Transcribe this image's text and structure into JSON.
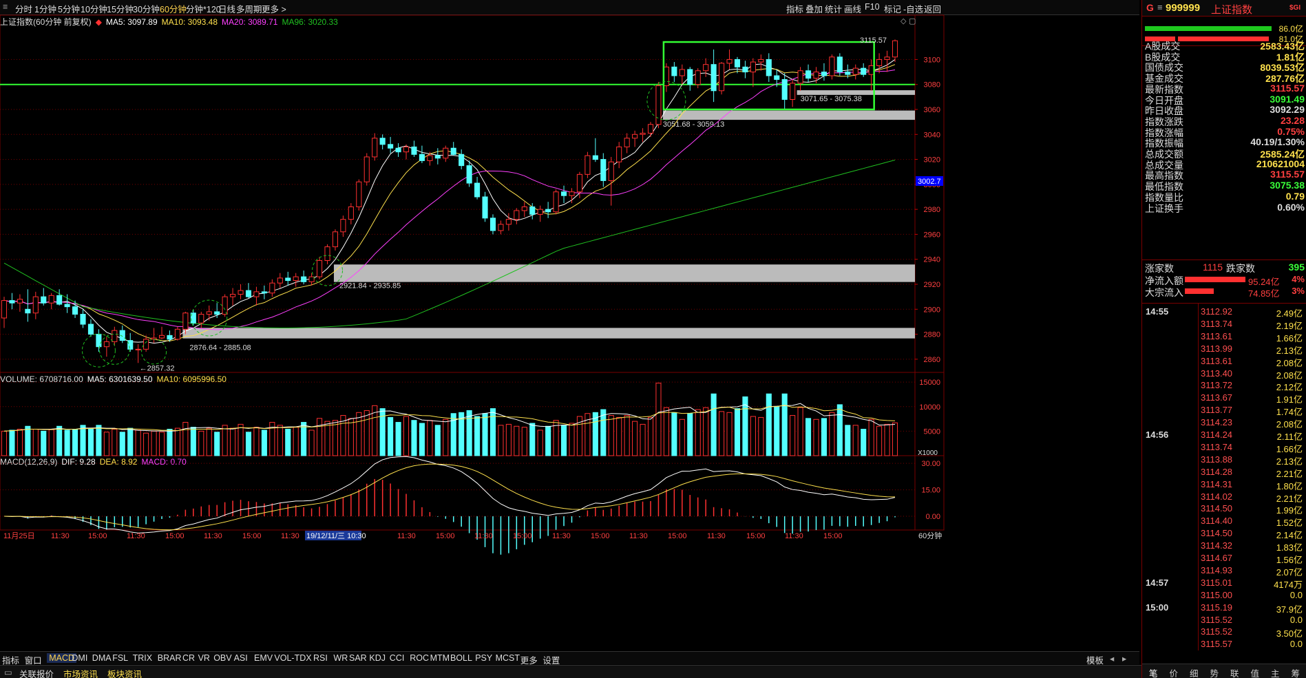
{
  "toolbar": {
    "periods": [
      "分时",
      "1分钟",
      "5分钟",
      "10分钟",
      "15分钟",
      "30分钟",
      "60分钟",
      "分钟*120",
      "日线",
      "多周期",
      "更多 >"
    ],
    "active_period": "60分钟",
    "right_buttons": [
      "指标",
      "叠加",
      "统计",
      "画线",
      "F10",
      "标记",
      "-自选",
      "返回"
    ]
  },
  "header": {
    "code_prefix": "G",
    "code": "999999",
    "name": "上证指数",
    "badge": "$GI"
  },
  "main_info": {
    "title": "上证指数(60分钟 前复权)",
    "ma5": "MA5: 3097.89",
    "ma10": "MA10: 3093.48",
    "ma20": "MA20: 3089.71",
    "ma96": "MA96: 3020.33"
  },
  "volume_info": {
    "title": "VOLUME: 6708716.00",
    "ma5": "MA5: 6301639.50",
    "ma10": "MA10: 6095996.50"
  },
  "macd_info": {
    "title": "MACD(12,26,9)",
    "dif": "DIF: 9.28",
    "dea": "DEA: 8.92",
    "macd": "MACD: 0.70"
  },
  "colors": {
    "up": "#ff3030",
    "down": "#54ffff",
    "ma5": "#ffffff",
    "ma10": "#ffe14d",
    "ma20": "#ff40ff",
    "ma96": "#20c020",
    "box": "#33ff33",
    "band": "#bbbbbb",
    "grid": "#7a0000"
  },
  "chart_data": {
    "type": "candlestick",
    "price_axis": {
      "ylim": [
        2850,
        3130
      ],
      "ticks": [
        2860,
        2880,
        2900,
        2920,
        2940,
        2960,
        2980,
        3000,
        3020,
        3040,
        3060,
        3080,
        3100
      ]
    },
    "volume_axis": {
      "ylim": [
        0,
        16000
      ],
      "ticks": [
        5000,
        10000,
        15000
      ],
      "unit": "X1000"
    },
    "macd_axis": {
      "ylim": [
        -7,
        32
      ],
      "ticks": [
        0.0,
        15.0,
        30.0
      ]
    },
    "current_price_label": "3002.7",
    "time_labels": [
      "11月25日",
      "11:30",
      "15:00",
      "11:30",
      "15:00",
      "11:30",
      "15:00",
      "11:30",
      "15:00",
      "19/12/11/三 10:30",
      "11:30",
      "15:00",
      "11:30",
      "15:00",
      "11:30",
      "15:00",
      "11:30",
      "15:00",
      "11:30",
      "15:00",
      "11:30",
      "15:00"
    ],
    "period_label": "60分钟",
    "annotations": {
      "high": "3115.57",
      "low": "2857.32",
      "zones": [
        "2876.64 - 2885.08",
        "2921.84 - 2935.85",
        "3051.68 - 3059.13",
        "3071.65 - 3075.38"
      ]
    },
    "candles": [
      [
        2893,
        2910,
        2885,
        2907,
        5000
      ],
      [
        2907,
        2913,
        2900,
        2905,
        5200
      ],
      [
        2905,
        2912,
        2898,
        2908,
        5400
      ],
      [
        2900,
        2916,
        2890,
        2897,
        6000
      ],
      [
        2897,
        2914,
        2892,
        2910,
        5400
      ],
      [
        2910,
        2917,
        2903,
        2905,
        5000
      ],
      [
        2905,
        2913,
        2900,
        2911,
        5300
      ],
      [
        2911,
        2916,
        2903,
        2904,
        6000
      ],
      [
        2904,
        2912,
        2897,
        2902,
        5200
      ],
      [
        2902,
        2907,
        2893,
        2896,
        5400
      ],
      [
        2896,
        2900,
        2885,
        2888,
        6200
      ],
      [
        2888,
        2892,
        2878,
        2880,
        5400
      ],
      [
        2880,
        2884,
        2866,
        2870,
        6200
      ],
      [
        2870,
        2878,
        2862,
        2874,
        4800
      ],
      [
        2874,
        2886,
        2871,
        2883,
        5400
      ],
      [
        2883,
        2887,
        2873,
        2875,
        4800
      ],
      [
        2875,
        2881,
        2866,
        2868,
        5600
      ],
      [
        2868,
        2872,
        2857,
        2868,
        5200
      ],
      [
        2868,
        2879,
        2866,
        2876,
        4600
      ],
      [
        2876,
        2885,
        2873,
        2877,
        5000
      ],
      [
        2877,
        2886,
        2876,
        2879,
        4800
      ],
      [
        2879,
        2883,
        2874,
        2876,
        5400
      ],
      [
        2876,
        2886,
        2875,
        2884,
        5600
      ],
      [
        2884,
        2898,
        2880,
        2897,
        6800
      ],
      [
        2897,
        2900,
        2887,
        2889,
        5800
      ],
      [
        2889,
        2898,
        2885,
        2896,
        5000
      ],
      [
        2896,
        2903,
        2891,
        2898,
        5600
      ],
      [
        2898,
        2905,
        2893,
        2896,
        4800
      ],
      [
        2896,
        2912,
        2894,
        2910,
        6200
      ],
      [
        2910,
        2917,
        2903,
        2912,
        5600
      ],
      [
        2912,
        2920,
        2908,
        2915,
        6400
      ],
      [
        2915,
        2921,
        2909,
        2910,
        4800
      ],
      [
        2910,
        2918,
        2903,
        2914,
        5800
      ],
      [
        2914,
        2919,
        2908,
        2913,
        5200
      ],
      [
        2913,
        2924,
        2910,
        2921,
        6800
      ],
      [
        2921,
        2929,
        2917,
        2925,
        6200
      ],
      [
        2925,
        2930,
        2919,
        2923,
        5400
      ],
      [
        2923,
        2929,
        2918,
        2926,
        5800
      ],
      [
        2926,
        2931,
        2920,
        2922,
        6800
      ],
      [
        2922,
        2929,
        2919,
        2926,
        5200
      ],
      [
        2926,
        2942,
        2924,
        2939,
        7600
      ],
      [
        2939,
        2952,
        2936,
        2950,
        7000
      ],
      [
        2950,
        2964,
        2947,
        2962,
        7200
      ],
      [
        2962,
        2975,
        2958,
        2972,
        8200
      ],
      [
        2972,
        2985,
        2968,
        2982,
        7600
      ],
      [
        2982,
        3004,
        2979,
        3002,
        8800
      ],
      [
        3002,
        3025,
        2999,
        3022,
        9200
      ],
      [
        3022,
        3041,
        3019,
        3037,
        10200
      ],
      [
        3037,
        3040,
        3028,
        3032,
        9600
      ],
      [
        3032,
        3038,
        3025,
        3029,
        7800
      ],
      [
        3029,
        3033,
        3022,
        3026,
        6800
      ],
      [
        3026,
        3032,
        3020,
        3030,
        8000
      ],
      [
        3030,
        3035,
        3022,
        3024,
        7200
      ],
      [
        3024,
        3031,
        3017,
        3019,
        6600
      ],
      [
        3019,
        3026,
        3015,
        3023,
        7200
      ],
      [
        3023,
        3029,
        3016,
        3021,
        6200
      ],
      [
        3021,
        3031,
        3018,
        3029,
        7400
      ],
      [
        3029,
        3034,
        3023,
        3024,
        8600
      ],
      [
        3024,
        3028,
        3012,
        3015,
        8800
      ],
      [
        3015,
        3019,
        2998,
        3001,
        9200
      ],
      [
        3001,
        3006,
        2988,
        2990,
        8000
      ],
      [
        2990,
        2994,
        2970,
        2973,
        8600
      ],
      [
        2973,
        2976,
        2960,
        2963,
        9600
      ],
      [
        2963,
        2971,
        2960,
        2968,
        6200
      ],
      [
        2968,
        2977,
        2963,
        2972,
        6400
      ],
      [
        2972,
        2981,
        2968,
        2979,
        6000
      ],
      [
        2979,
        2986,
        2974,
        2982,
        5800
      ],
      [
        2982,
        2985,
        2972,
        2976,
        6600
      ],
      [
        2976,
        2983,
        2970,
        2980,
        5200
      ],
      [
        2980,
        2986,
        2973,
        2978,
        6000
      ],
      [
        2978,
        2996,
        2976,
        2994,
        7200
      ],
      [
        2994,
        2999,
        2985,
        2991,
        6200
      ],
      [
        2991,
        2997,
        2985,
        2994,
        6600
      ],
      [
        2994,
        3010,
        2989,
        3008,
        8000
      ],
      [
        3008,
        3026,
        3005,
        3023,
        8600
      ],
      [
        3023,
        3037,
        3018,
        3020,
        8800
      ],
      [
        3020,
        3025,
        2998,
        3003,
        9400
      ],
      [
        3003,
        3022,
        2983,
        3018,
        8200
      ],
      [
        3018,
        3034,
        3013,
        3030,
        7800
      ],
      [
        3030,
        3041,
        3025,
        3037,
        8200
      ],
      [
        3037,
        3043,
        3030,
        3040,
        7000
      ],
      [
        3040,
        3045,
        3034,
        3041,
        6400
      ],
      [
        3041,
        3050,
        3038,
        3048,
        7800
      ],
      [
        3048,
        3082,
        3045,
        3079,
        14800
      ],
      [
        3079,
        3097,
        3074,
        3094,
        9800
      ],
      [
        3094,
        3098,
        3082,
        3087,
        8800
      ],
      [
        3087,
        3096,
        3080,
        3092,
        7400
      ],
      [
        3092,
        3094,
        3075,
        3080,
        8600
      ],
      [
        3080,
        3093,
        3077,
        3091,
        9400
      ],
      [
        3091,
        3101,
        3086,
        3096,
        9800
      ],
      [
        3096,
        3108,
        3066,
        3075,
        12600
      ],
      [
        3075,
        3098,
        3072,
        3097,
        9000
      ],
      [
        3097,
        3108,
        3092,
        3100,
        8800
      ],
      [
        3100,
        3102,
        3089,
        3094,
        9600
      ],
      [
        3094,
        3099,
        3085,
        3090,
        12000
      ],
      [
        3090,
        3101,
        3078,
        3098,
        8000
      ],
      [
        3098,
        3104,
        3091,
        3100,
        7800
      ],
      [
        3100,
        3105,
        3082,
        3087,
        12600
      ],
      [
        3087,
        3092,
        3078,
        3084,
        10000
      ],
      [
        3084,
        3089,
        3060,
        3068,
        12600
      ],
      [
        3068,
        3084,
        3062,
        3081,
        8200
      ],
      [
        3081,
        3094,
        3075,
        3091,
        9800
      ],
      [
        3091,
        3096,
        3082,
        3085,
        7600
      ],
      [
        3085,
        3094,
        3081,
        3090,
        7400
      ],
      [
        3090,
        3097,
        3083,
        3087,
        7600
      ],
      [
        3087,
        3104,
        3084,
        3102,
        8800
      ],
      [
        3102,
        3105,
        3087,
        3090,
        10400
      ],
      [
        3090,
        3096,
        3085,
        3088,
        6200
      ],
      [
        3088,
        3096,
        3084,
        3093,
        6200
      ],
      [
        3093,
        3097,
        3086,
        3088,
        5400
      ],
      [
        3088,
        3100,
        3075,
        3095,
        7400
      ],
      [
        3095,
        3105,
        3089,
        3100,
        6000
      ],
      [
        3100,
        3107,
        3090,
        3102,
        6400
      ],
      [
        3102,
        3116,
        3098,
        3115,
        6700
      ]
    ]
  },
  "right_panel": {
    "pct_top": "86.0亿",
    "pct_bottom": "81.0亿",
    "stats": [
      {
        "label": "A股成交",
        "value": "2583.43亿",
        "color": "yellow"
      },
      {
        "label": "B股成交",
        "value": "1.81亿",
        "color": "yellow"
      },
      {
        "label": "国债成交",
        "value": "8039.53亿",
        "color": "yellow"
      },
      {
        "label": "基金成交",
        "value": "287.76亿",
        "color": "yellow"
      },
      {
        "label": "最新指数",
        "value": "3115.57",
        "color": "red"
      },
      {
        "label": "今日开盘",
        "value": "3091.49",
        "color": "green"
      },
      {
        "label": "昨日收盘",
        "value": "3092.29",
        "color": "white"
      },
      {
        "label": "指数涨跌",
        "value": "23.28",
        "color": "red"
      },
      {
        "label": "指数涨幅",
        "value": "0.75%",
        "color": "red"
      },
      {
        "label": "指数振幅",
        "value": "40.19/1.30%",
        "color": "white"
      },
      {
        "label": "总成交额",
        "value": "2585.24亿",
        "color": "yellow"
      },
      {
        "label": "总成交量",
        "value": "210621004",
        "color": "yellow"
      },
      {
        "label": "最高指数",
        "value": "3115.57",
        "color": "red"
      },
      {
        "label": "最低指数",
        "value": "3075.38",
        "color": "green"
      },
      {
        "label": "指数量比",
        "value": "0.79",
        "color": "yellow"
      },
      {
        "label": "上证换手",
        "value": "0.60%",
        "color": "white"
      }
    ],
    "breadth": {
      "up_label": "涨家数",
      "up_value": "1115",
      "down_label": "跌家数",
      "down_value": "395"
    },
    "flows": [
      {
        "label": "净流入额",
        "value": "95.24亿",
        "pct": "4%"
      },
      {
        "label": "大宗流入",
        "value": "74.85亿",
        "pct": "3%"
      }
    ],
    "ticks": [
      {
        "time": "14:55",
        "price": "3112.92",
        "vol": "2.49亿"
      },
      {
        "time": "",
        "price": "3113.74",
        "vol": "2.19亿"
      },
      {
        "time": "",
        "price": "3113.61",
        "vol": "1.66亿"
      },
      {
        "time": "",
        "price": "3113.99",
        "vol": "2.13亿"
      },
      {
        "time": "",
        "price": "3113.61",
        "vol": "2.08亿"
      },
      {
        "time": "",
        "price": "3113.40",
        "vol": "2.08亿"
      },
      {
        "time": "",
        "price": "3113.72",
        "vol": "2.12亿"
      },
      {
        "time": "",
        "price": "3113.67",
        "vol": "1.91亿"
      },
      {
        "time": "",
        "price": "3113.77",
        "vol": "1.74亿"
      },
      {
        "time": "",
        "price": "3114.23",
        "vol": "2.08亿"
      },
      {
        "time": "14:56",
        "price": "3114.24",
        "vol": "2.11亿"
      },
      {
        "time": "",
        "price": "3113.74",
        "vol": "1.66亿"
      },
      {
        "time": "",
        "price": "3113.88",
        "vol": "2.13亿"
      },
      {
        "time": "",
        "price": "3114.28",
        "vol": "2.21亿"
      },
      {
        "time": "",
        "price": "3114.31",
        "vol": "1.80亿"
      },
      {
        "time": "",
        "price": "3114.02",
        "vol": "2.21亿"
      },
      {
        "time": "",
        "price": "3114.50",
        "vol": "1.99亿"
      },
      {
        "time": "",
        "price": "3114.40",
        "vol": "1.52亿"
      },
      {
        "time": "",
        "price": "3114.50",
        "vol": "2.14亿"
      },
      {
        "time": "",
        "price": "3114.32",
        "vol": "1.83亿"
      },
      {
        "time": "",
        "price": "3114.67",
        "vol": "1.56亿"
      },
      {
        "time": "",
        "price": "3114.93",
        "vol": "2.07亿"
      },
      {
        "time": "14:57",
        "price": "3115.01",
        "vol": "4174万"
      },
      {
        "time": "",
        "price": "3115.00",
        "vol": "0.0"
      },
      {
        "time": "15:00",
        "price": "3115.19",
        "vol": "37.9亿"
      },
      {
        "time": "",
        "price": "3115.52",
        "vol": "0.0"
      },
      {
        "time": "",
        "price": "3115.52",
        "vol": "3.50亿"
      },
      {
        "time": "",
        "price": "3115.57",
        "vol": "0.0"
      }
    ],
    "bottom_tabs": [
      "笔",
      "价",
      "细",
      "势",
      "联",
      "值",
      "主",
      "筹"
    ]
  },
  "indicator_tabs": [
    "指标",
    "窗口",
    "MACD",
    "DMI",
    "DMA",
    "FSL",
    "TRIX",
    "BRAR",
    "CR",
    "VR",
    "OBV",
    "ASI",
    "EMV",
    "VOL-TDX",
    "RSI",
    "WR",
    "SAR",
    "KDJ",
    "CCI",
    "ROC",
    "MTM",
    "BOLL",
    "PSY",
    "MCST",
    "更多",
    "设置"
  ],
  "active_indicator": "MACD",
  "template_button": "模板",
  "status_tabs": [
    "关联报价",
    "市场资讯",
    "板块资讯"
  ]
}
